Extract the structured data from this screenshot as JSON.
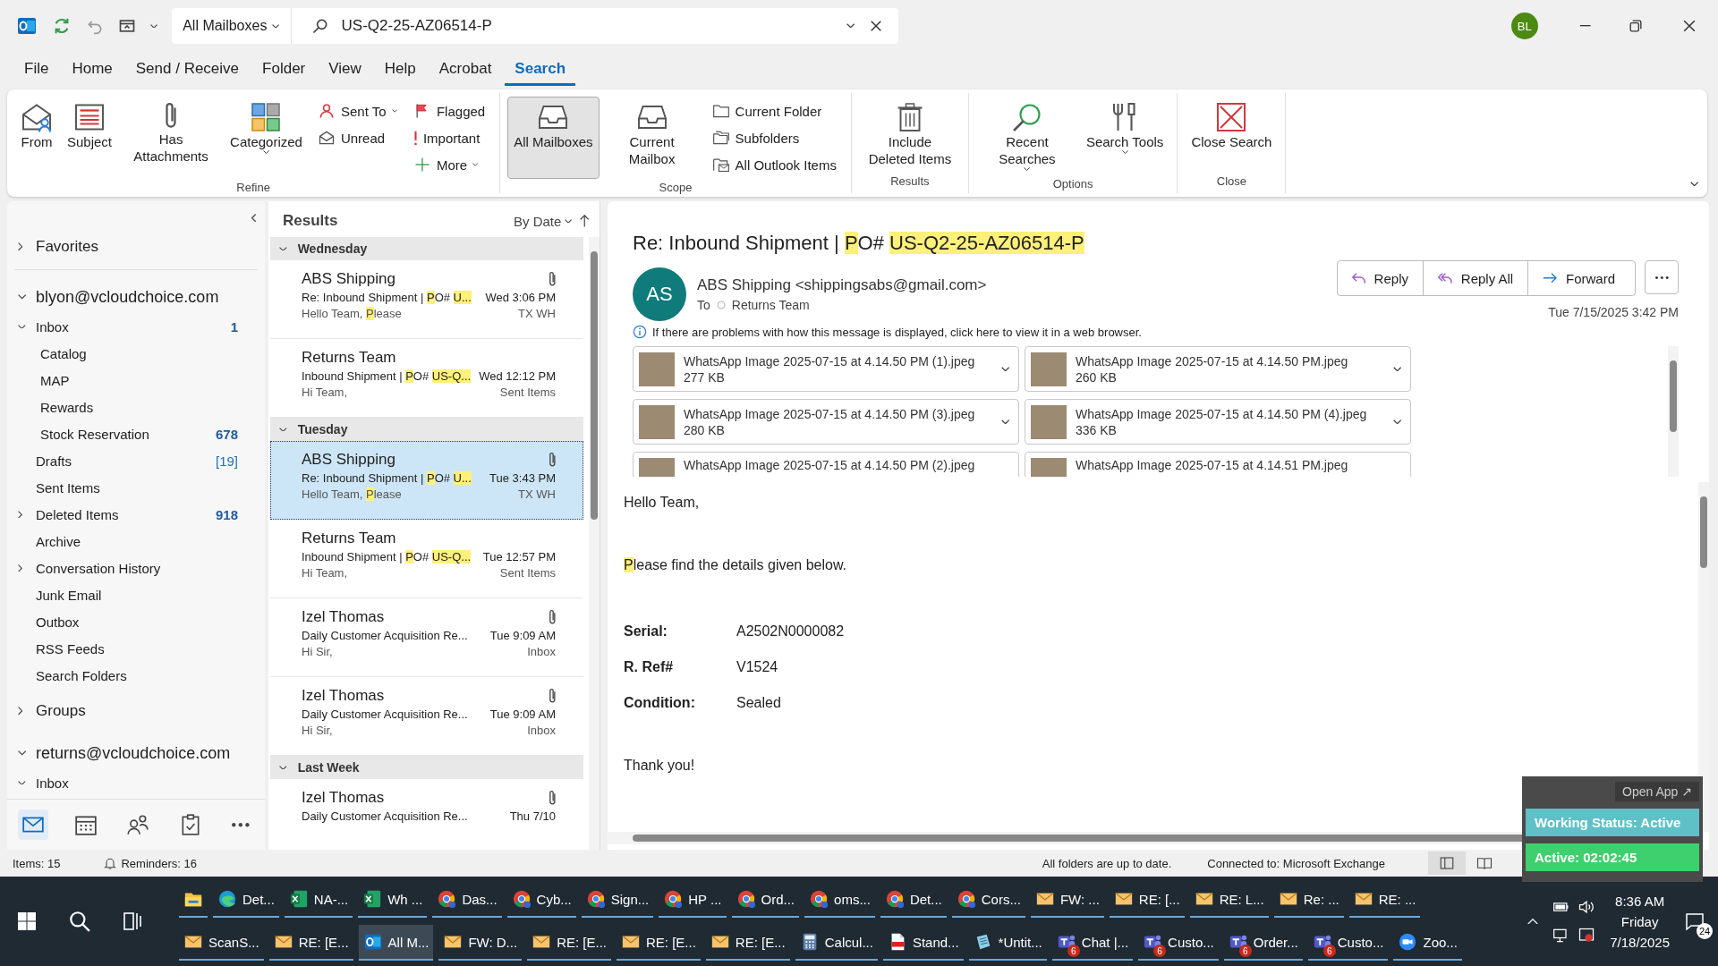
{
  "title_bar": {
    "scope": "All Mailboxes",
    "search_value": "US-Q2-25-AZ06514-P",
    "avatar": "BL"
  },
  "menu_tabs": [
    {
      "label": "File",
      "selected": false
    },
    {
      "label": "Home",
      "selected": false
    },
    {
      "label": "Send / Receive",
      "selected": false
    },
    {
      "label": "Folder",
      "selected": false
    },
    {
      "label": "View",
      "selected": false
    },
    {
      "label": "Help",
      "selected": false
    },
    {
      "label": "Acrobat",
      "selected": false
    },
    {
      "label": "Search",
      "selected": true
    }
  ],
  "ribbon": [
    {
      "label": "Refine",
      "columns": [
        {
          "kind": "large",
          "label": "From",
          "caret": false
        },
        {
          "kind": "large",
          "label": "Subject",
          "caret": false
        },
        {
          "kind": "large",
          "label": "Has Attachments",
          "caret": false
        },
        {
          "kind": "large",
          "label": "Categorized",
          "caret": true
        },
        {
          "kind": "stack",
          "items": [
            {
              "label": "Sent To",
              "caret": true
            },
            {
              "label": "Unread",
              "caret": false
            }
          ]
        },
        {
          "kind": "stack",
          "items": [
            {
              "label": "Flagged",
              "caret": false
            },
            {
              "label": "Important",
              "caret": false
            },
            {
              "label": "More",
              "caret": true
            }
          ]
        }
      ]
    },
    {
      "label": "Scope",
      "columns": [
        {
          "kind": "large",
          "label": "All Mailboxes",
          "caret": false,
          "selected": true
        },
        {
          "kind": "large",
          "label": "Current Mailbox",
          "caret": false,
          "selected": false
        },
        {
          "kind": "stack",
          "items": [
            {
              "label": "Current Folder",
              "caret": false,
              "selected": false
            },
            {
              "label": "Subfolders",
              "caret": false,
              "selected": false
            },
            {
              "label": "All Outlook Items",
              "caret": false,
              "selected": false
            }
          ]
        }
      ]
    },
    {
      "label": "Results",
      "columns": [
        {
          "kind": "large",
          "label": "Include Deleted Items",
          "caret": false
        }
      ]
    },
    {
      "label": "Options",
      "columns": [
        {
          "kind": "large",
          "label": "Recent Searches",
          "caret": true
        },
        {
          "kind": "large",
          "label": "Search Tools",
          "caret": true
        }
      ]
    },
    {
      "label": "Close",
      "columns": [
        {
          "kind": "large",
          "label": "Close Search",
          "caret": false
        }
      ]
    }
  ],
  "folder_pane": {
    "favorites": {
      "label": "Favorites",
      "expanded": false
    },
    "accounts": [
      {
        "label": "blyon@vcloudchoice.com",
        "expanded": true,
        "folders": [
          {
            "label": "Inbox",
            "expanded": true,
            "count": "1",
            "kind": "unread",
            "children": [
              {
                "label": "Catalog"
              },
              {
                "label": "MAP"
              },
              {
                "label": "Rewards"
              },
              {
                "label": "Stock Reservation",
                "count": "678",
                "kind": "unread"
              }
            ]
          },
          {
            "label": "Drafts",
            "count": "[19]",
            "kind": "total"
          },
          {
            "label": "Sent Items"
          },
          {
            "label": "Deleted Items",
            "expanded": false,
            "count": "918",
            "kind": "unread"
          },
          {
            "label": "Archive"
          },
          {
            "label": "Conversation History",
            "expanded": false
          },
          {
            "label": "Junk Email"
          },
          {
            "label": "Outbox"
          },
          {
            "label": "RSS Feeds"
          },
          {
            "label": "Search Folders"
          }
        ],
        "groups": {
          "label": "Groups",
          "expanded": false
        }
      },
      {
        "label": "returns@vcloudchoice.com",
        "expanded": true,
        "folders": [
          {
            "label": "Inbox",
            "expanded": true
          }
        ]
      }
    ],
    "nav": [
      {
        "kind": "mail",
        "selected": true
      },
      {
        "kind": "calendar",
        "selected": false
      },
      {
        "kind": "people",
        "selected": false
      },
      {
        "kind": "tasks",
        "selected": false
      },
      {
        "kind": "more",
        "selected": false
      }
    ]
  },
  "message_list": {
    "title": "Results",
    "sort": "By Date",
    "groups": [
      {
        "label": "Wednesday",
        "expanded": true,
        "messages": [
          {
            "sender": "ABS Shipping",
            "subject": [
              {
                "text": "Re: Inbound Shipment | ",
                "hit": false
              },
              {
                "text": "P",
                "hit": true
              },
              {
                "text": "O# ",
                "hit": false
              },
              {
                "text": "U...",
                "hit": true
              }
            ],
            "preview": [
              {
                "text": "Hello Team,  ",
                "hit": false
              },
              {
                "text": "P",
                "hit": true
              },
              {
                "text": "lease",
                "hit": false
              }
            ],
            "time": "Wed 3:06 PM",
            "folder": "TX WH",
            "attachment": true,
            "selected": false
          },
          {
            "sender": "Returns Team",
            "subject": [
              {
                "text": "Inbound Shipment | ",
                "hit": false
              },
              {
                "text": "P",
                "hit": true
              },
              {
                "text": "O# ",
                "hit": false
              },
              {
                "text": "US-Q...",
                "hit": true
              }
            ],
            "preview": [
              {
                "text": "Hi Team,",
                "hit": false
              }
            ],
            "time": "Wed 12:12 PM",
            "folder": "Sent Items",
            "attachment": false,
            "selected": false
          }
        ]
      },
      {
        "label": "Tuesday",
        "expanded": true,
        "messages": [
          {
            "sender": "ABS Shipping",
            "subject": [
              {
                "text": "Re: Inbound Shipment | ",
                "hit": false
              },
              {
                "text": "P",
                "hit": true
              },
              {
                "text": "O# ",
                "hit": false
              },
              {
                "text": "U...",
                "hit": true
              }
            ],
            "preview": [
              {
                "text": "Hello Team,  ",
                "hit": false
              },
              {
                "text": "P",
                "hit": true
              },
              {
                "text": "lease",
                "hit": false
              }
            ],
            "time": "Tue 3:43 PM",
            "folder": "TX WH",
            "attachment": true,
            "selected": true
          },
          {
            "sender": "Returns Team",
            "subject": [
              {
                "text": "Inbound Shipment | ",
                "hit": false
              },
              {
                "text": "P",
                "hit": true
              },
              {
                "text": "O# ",
                "hit": false
              },
              {
                "text": "US-Q...",
                "hit": true
              }
            ],
            "preview": [
              {
                "text": "Hi Team,",
                "hit": false
              }
            ],
            "time": "Tue 12:57 PM",
            "folder": "Sent Items",
            "attachment": false,
            "selected": false
          },
          {
            "sender": "Izel Thomas",
            "subject": [
              {
                "text": "Daily Customer Acquisition Re...",
                "hit": false
              }
            ],
            "preview": [
              {
                "text": "Hi Sir,",
                "hit": false
              }
            ],
            "time": "Tue 9:09 AM",
            "folder": "Inbox",
            "attachment": true,
            "selected": false
          },
          {
            "sender": "Izel Thomas",
            "subject": [
              {
                "text": "Daily Customer Acquisition Re...",
                "hit": false
              }
            ],
            "preview": [
              {
                "text": "Hi Sir,",
                "hit": false
              }
            ],
            "time": "Tue 9:09 AM",
            "folder": "Inbox",
            "attachment": true,
            "selected": false
          }
        ]
      },
      {
        "label": "Last Week",
        "expanded": true,
        "messages": [
          {
            "sender": "Izel Thomas",
            "subject": [
              {
                "text": "Daily Customer Acquisition Re...",
                "hit": false
              }
            ],
            "time": "Thu 7/10",
            "attachment": true,
            "selected": false
          }
        ]
      }
    ]
  },
  "reading_pane": {
    "subject": [
      {
        "text": "Re: Inbound Shipment | ",
        "hit": false
      },
      {
        "text": "P",
        "hit": true
      },
      {
        "text": "O# ",
        "hit": false
      },
      {
        "text": "US-Q2-25-AZ06514-P",
        "hit": true
      }
    ],
    "avatar": "AS",
    "sender": "ABS Shipping <shippingsabs@gmail.com>",
    "to_label": "To",
    "to": "Returns Team",
    "actions": [
      {
        "label": "Reply"
      },
      {
        "label": "Reply All"
      },
      {
        "label": "Forward"
      }
    ],
    "date": "Tue 7/15/2025 3:42 PM",
    "info": "If there are problems with how this message is displayed, click here to view it in a web browser.",
    "attachments": [
      {
        "name": "WhatsApp Image 2025-07-15 at 4.14.50 PM (1).jpeg",
        "size": "277 KB"
      },
      {
        "name": "WhatsApp Image 2025-07-15 at 4.14.50 PM.jpeg",
        "size": "260 KB"
      },
      {
        "name": "WhatsApp Image 2025-07-15 at 4.14.50 PM (3).jpeg",
        "size": "280 KB"
      },
      {
        "name": "WhatsApp Image 2025-07-15 at 4.14.50 PM (4).jpeg",
        "size": "336 KB"
      },
      {
        "name": "WhatsApp Image 2025-07-15 at 4.14.50 PM (2).jpeg"
      },
      {
        "name": "WhatsApp Image 2025-07-15 at 4.14.51 PM.jpeg"
      }
    ],
    "body": {
      "greeting": "Hello Team,",
      "intro": [
        {
          "text": "P",
          "hit": true
        },
        {
          "text": "lease find the details given below.",
          "hit": false
        }
      ],
      "fields": [
        {
          "label": "Serial:",
          "value": "A2502N0000082"
        },
        {
          "label": "R. Ref#",
          "value": "V1524"
        },
        {
          "label": "Condition:",
          "value": "Sealed"
        }
      ],
      "closing": "Thank you!"
    }
  },
  "status_bar": {
    "items": "Items: 15",
    "reminders": "Reminders: 16",
    "sync": "All folders are up to date.",
    "connection": "Connected to: Microsoft Exchange"
  },
  "overlay": {
    "open_app": "Open App ↗",
    "status": "Working Status: Active",
    "timer": "Active: 02:02:45"
  },
  "taskbar": {
    "rows": [
      {
        "buttons": [
          {
            "kind": "explorer",
            "selected": false
          },
          {
            "kind": "edge",
            "label": "Det...",
            "selected": false
          },
          {
            "kind": "excel",
            "label": "NA-...",
            "selected": false
          },
          {
            "kind": "excel",
            "label": "Wh ...",
            "selected": false
          },
          {
            "kind": "chrome",
            "label": "Das...",
            "selected": false
          },
          {
            "kind": "chrome",
            "label": "Cyb...",
            "selected": false
          },
          {
            "kind": "chrome",
            "label": "Sign...",
            "selected": false
          },
          {
            "kind": "chrome",
            "label": "HP ...",
            "selected": false
          },
          {
            "kind": "chrome",
            "label": "Ord...",
            "selected": false
          },
          {
            "kind": "chrome",
            "label": "oms...",
            "selected": false
          },
          {
            "kind": "chrome",
            "label": "Det...",
            "selected": false
          },
          {
            "kind": "chrome",
            "label": "Cors...",
            "selected": false
          },
          {
            "kind": "mail",
            "label": "FW: ...",
            "selected": false
          },
          {
            "kind": "mail",
            "label": "RE: [...",
            "selected": false
          },
          {
            "kind": "mail",
            "label": "RE: L...",
            "selected": false
          },
          {
            "kind": "mail",
            "label": "Re: ...",
            "selected": false
          },
          {
            "kind": "mail",
            "label": "RE: ...",
            "selected": false
          }
        ]
      },
      {
        "buttons": [
          {
            "kind": "mail",
            "label": "ScanS...",
            "selected": false
          },
          {
            "kind": "mail",
            "label": "RE: [E...",
            "selected": false
          },
          {
            "kind": "outlook",
            "label": "All M...",
            "selected": true
          },
          {
            "kind": "mail",
            "label": "FW: D...",
            "selected": false
          },
          {
            "kind": "mail",
            "label": "RE: [E...",
            "selected": false
          },
          {
            "kind": "mail",
            "label": "RE: [E...",
            "selected": false
          },
          {
            "kind": "mail",
            "label": "RE: [E...",
            "selected": false
          },
          {
            "kind": "calc",
            "label": "Calcul...",
            "selected": false
          },
          {
            "kind": "pdf",
            "label": "Stand...",
            "selected": false
          },
          {
            "kind": "notepad",
            "label": "*Untit...",
            "selected": false
          },
          {
            "kind": "teams",
            "label": "Chat |...",
            "badge": "6",
            "selected": false
          },
          {
            "kind": "teams",
            "label": "Custo...",
            "badge": "6",
            "selected": false
          },
          {
            "kind": "teams",
            "label": "Order...",
            "badge": "6",
            "selected": false
          },
          {
            "kind": "teams",
            "label": "Custo...",
            "badge": "6",
            "selected": false
          },
          {
            "kind": "zoom",
            "label": "Zoo...",
            "selected": false
          }
        ]
      }
    ],
    "time": "8:36 AM",
    "day": "Friday",
    "date": "7/18/2025",
    "notifications": "24"
  }
}
